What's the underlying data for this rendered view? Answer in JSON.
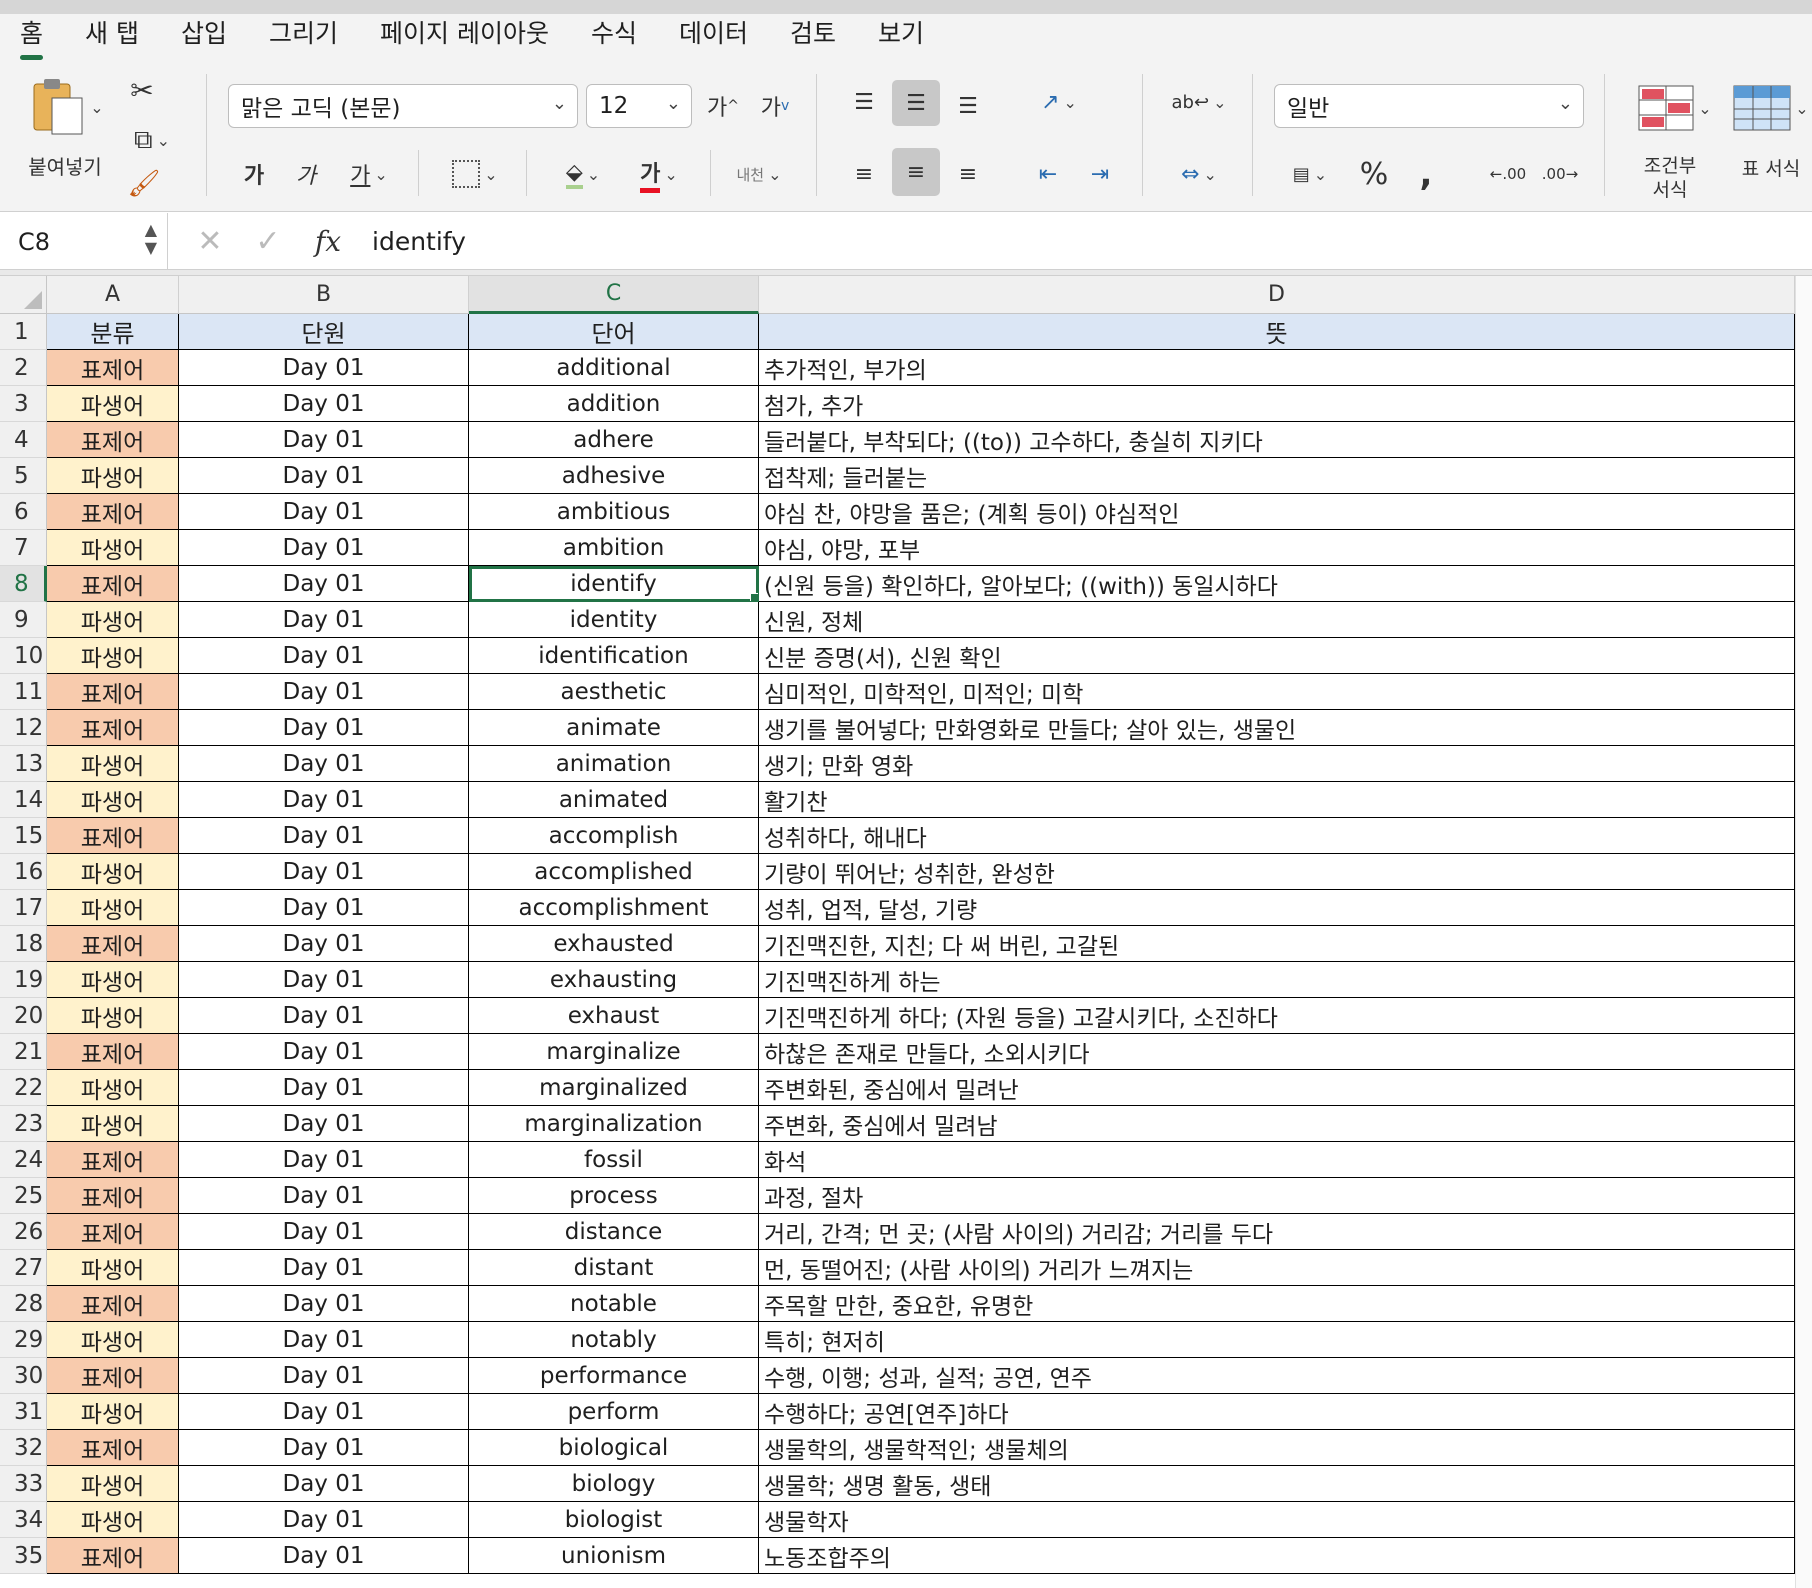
{
  "tabs": [
    "홈",
    "새 탭",
    "삽입",
    "그리기",
    "페이지 레이아웃",
    "수식",
    "데이터",
    "검토",
    "보기"
  ],
  "ribbon": {
    "paste_label": "붙여넣기",
    "font_name": "맑은 고딕 (본문)",
    "font_size": "12",
    "grow_font": "가",
    "shrink_font": "가",
    "bold": "가",
    "italic": "가",
    "underline": "가",
    "font_color_glyph": "가",
    "phonetic": "내천",
    "number_format": "일반",
    "conditional_format_label": "조건부\n서식",
    "table_format_label": "표 서식",
    "accent_color": "#217346",
    "font_color": "#e81123"
  },
  "formula_bar": {
    "name_box": "C8",
    "fx": "fx",
    "content": "identify"
  },
  "sheet": {
    "columns": [
      "A",
      "B",
      "C",
      "D"
    ],
    "selected_column": "C",
    "selected_row": "8",
    "header": [
      "분류",
      "단원",
      "단어",
      "뜻"
    ],
    "rows": [
      {
        "n": "2",
        "cat": "표제어",
        "unit": "Day 01",
        "word": "additional",
        "meaning": "추가적인, 부가의"
      },
      {
        "n": "3",
        "cat": "파생어",
        "unit": "Day 01",
        "word": "addition",
        "meaning": "첨가, 추가"
      },
      {
        "n": "4",
        "cat": "표제어",
        "unit": "Day 01",
        "word": "adhere",
        "meaning": "들러붙다, 부착되다; ((to)) 고수하다, 충실히 지키다"
      },
      {
        "n": "5",
        "cat": "파생어",
        "unit": "Day 01",
        "word": "adhesive",
        "meaning": "접착제; 들러붙는"
      },
      {
        "n": "6",
        "cat": "표제어",
        "unit": "Day 01",
        "word": "ambitious",
        "meaning": "야심 찬, 야망을 품은; (계획 등이) 야심적인"
      },
      {
        "n": "7",
        "cat": "파생어",
        "unit": "Day 01",
        "word": "ambition",
        "meaning": "야심, 야망, 포부"
      },
      {
        "n": "8",
        "cat": "표제어",
        "unit": "Day 01",
        "word": "identify",
        "meaning": "(신원 등을) 확인하다, 알아보다; ((with)) 동일시하다"
      },
      {
        "n": "9",
        "cat": "파생어",
        "unit": "Day 01",
        "word": "identity",
        "meaning": "신원, 정체"
      },
      {
        "n": "10",
        "cat": "파생어",
        "unit": "Day 01",
        "word": "identification",
        "meaning": "신분 증명(서), 신원 확인"
      },
      {
        "n": "11",
        "cat": "표제어",
        "unit": "Day 01",
        "word": "aesthetic",
        "meaning": "심미적인, 미학적인, 미적인; 미학"
      },
      {
        "n": "12",
        "cat": "표제어",
        "unit": "Day 01",
        "word": "animate",
        "meaning": "생기를 불어넣다; 만화영화로 만들다; 살아 있는, 생물인"
      },
      {
        "n": "13",
        "cat": "파생어",
        "unit": "Day 01",
        "word": "animation",
        "meaning": "생기; 만화 영화"
      },
      {
        "n": "14",
        "cat": "파생어",
        "unit": "Day 01",
        "word": "animated",
        "meaning": "활기찬"
      },
      {
        "n": "15",
        "cat": "표제어",
        "unit": "Day 01",
        "word": "accomplish",
        "meaning": "성취하다, 해내다"
      },
      {
        "n": "16",
        "cat": "파생어",
        "unit": "Day 01",
        "word": "accomplished",
        "meaning": "기량이 뛰어난; 성취한, 완성한"
      },
      {
        "n": "17",
        "cat": "파생어",
        "unit": "Day 01",
        "word": "accomplishment",
        "meaning": "성취, 업적, 달성, 기량"
      },
      {
        "n": "18",
        "cat": "표제어",
        "unit": "Day 01",
        "word": "exhausted",
        "meaning": "기진맥진한, 지친; 다 써 버린, 고갈된"
      },
      {
        "n": "19",
        "cat": "파생어",
        "unit": "Day 01",
        "word": "exhausting",
        "meaning": "기진맥진하게 하는"
      },
      {
        "n": "20",
        "cat": "파생어",
        "unit": "Day 01",
        "word": "exhaust",
        "meaning": "기진맥진하게 하다; (자원 등을) 고갈시키다, 소진하다"
      },
      {
        "n": "21",
        "cat": "표제어",
        "unit": "Day 01",
        "word": "marginalize",
        "meaning": "하찮은 존재로 만들다, 소외시키다"
      },
      {
        "n": "22",
        "cat": "파생어",
        "unit": "Day 01",
        "word": "marginalized",
        "meaning": "주변화된, 중심에서 밀려난"
      },
      {
        "n": "23",
        "cat": "파생어",
        "unit": "Day 01",
        "word": "marginalization",
        "meaning": "주변화, 중심에서 밀려남"
      },
      {
        "n": "24",
        "cat": "표제어",
        "unit": "Day 01",
        "word": "fossil",
        "meaning": "화석"
      },
      {
        "n": "25",
        "cat": "표제어",
        "unit": "Day 01",
        "word": "process",
        "meaning": "과정, 절차"
      },
      {
        "n": "26",
        "cat": "표제어",
        "unit": "Day 01",
        "word": "distance",
        "meaning": "거리, 간격; 먼 곳; (사람 사이의) 거리감; 거리를 두다"
      },
      {
        "n": "27",
        "cat": "파생어",
        "unit": "Day 01",
        "word": "distant",
        "meaning": "먼, 동떨어진; (사람 사이의) 거리가 느껴지는"
      },
      {
        "n": "28",
        "cat": "표제어",
        "unit": "Day 01",
        "word": "notable",
        "meaning": "주목할 만한, 중요한, 유명한"
      },
      {
        "n": "29",
        "cat": "파생어",
        "unit": "Day 01",
        "word": "notably",
        "meaning": "특히; 현저히"
      },
      {
        "n": "30",
        "cat": "표제어",
        "unit": "Day 01",
        "word": "performance",
        "meaning": "수행, 이행; 성과, 실적; 공연, 연주"
      },
      {
        "n": "31",
        "cat": "파생어",
        "unit": "Day 01",
        "word": "perform",
        "meaning": "수행하다; 공연[연주]하다"
      },
      {
        "n": "32",
        "cat": "표제어",
        "unit": "Day 01",
        "word": "biological",
        "meaning": "생물학의, 생물학적인; 생물체의"
      },
      {
        "n": "33",
        "cat": "파생어",
        "unit": "Day 01",
        "word": "biology",
        "meaning": "생물학; 생명 활동, 생태"
      },
      {
        "n": "34",
        "cat": "파생어",
        "unit": "Day 01",
        "word": "biologist",
        "meaning": "생물학자"
      },
      {
        "n": "35",
        "cat": "표제어",
        "unit": "Day 01",
        "word": "unionism",
        "meaning": "노동조합주의"
      }
    ]
  }
}
